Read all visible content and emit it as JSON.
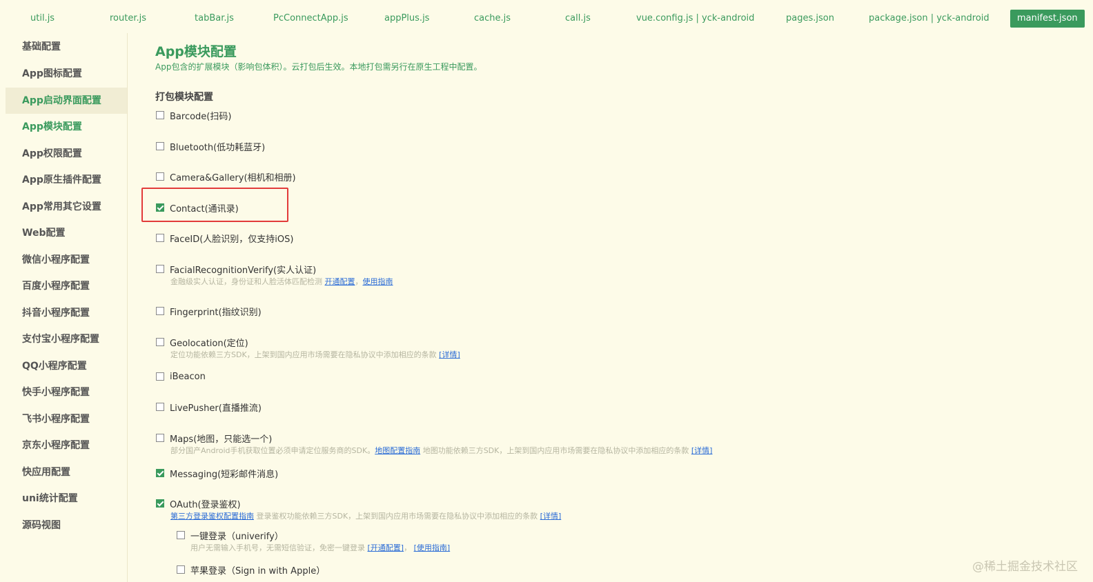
{
  "tabs": [
    {
      "label": "util.js",
      "active": false
    },
    {
      "label": "router.js",
      "active": false
    },
    {
      "label": "tabBar.js",
      "active": false
    },
    {
      "label": "PcConnectApp.js",
      "active": false
    },
    {
      "label": "appPlus.js",
      "active": false
    },
    {
      "label": "cache.js",
      "active": false
    },
    {
      "label": "call.js",
      "active": false
    },
    {
      "label": "vue.config.js | yck-android",
      "active": false
    },
    {
      "label": "pages.json",
      "active": false
    },
    {
      "label": "package.json | yck-android",
      "active": false
    },
    {
      "label": "manifest.json",
      "active": true
    }
  ],
  "sidebar": {
    "items": [
      {
        "label": "基础配置"
      },
      {
        "label": "App图标配置"
      },
      {
        "label": "App启动界面配置"
      },
      {
        "label": "App模块配置"
      },
      {
        "label": "App权限配置"
      },
      {
        "label": "App原生插件配置"
      },
      {
        "label": "App常用其它设置"
      },
      {
        "label": "Web配置"
      },
      {
        "label": "微信小程序配置"
      },
      {
        "label": "百度小程序配置"
      },
      {
        "label": "抖音小程序配置"
      },
      {
        "label": "支付宝小程序配置"
      },
      {
        "label": "QQ小程序配置"
      },
      {
        "label": "快手小程序配置"
      },
      {
        "label": "飞书小程序配置"
      },
      {
        "label": "京东小程序配置"
      },
      {
        "label": "快应用配置"
      },
      {
        "label": "uni统计配置"
      },
      {
        "label": "源码视图"
      }
    ]
  },
  "main": {
    "title": "App模块配置",
    "subtitle": "App包含的扩展模块（影响包体积）。云打包后生效。本地打包需另行在原生工程中配置。",
    "section_title": "打包模块配置",
    "modules": [
      {
        "label": "Barcode(扫码)",
        "checked": false
      },
      {
        "label": "Bluetooth(低功耗蓝牙)",
        "checked": false
      },
      {
        "label": "Camera&Gallery(相机和相册)",
        "checked": false
      },
      {
        "label": "Contact(通讯录)",
        "checked": true
      },
      {
        "label": "FaceID(人脸识别，仅支持iOS)",
        "checked": false
      },
      {
        "label": "FacialRecognitionVerify(实人认证)",
        "checked": false
      },
      {
        "label": "Fingerprint(指纹识别)",
        "checked": false
      },
      {
        "label": "Geolocation(定位)",
        "checked": false
      },
      {
        "label": "iBeacon",
        "checked": false
      },
      {
        "label": "LivePusher(直播推流)",
        "checked": false
      },
      {
        "label": "Maps(地图，只能选一个)",
        "checked": false
      },
      {
        "label": "Messaging(短彩邮件消息)",
        "checked": true
      },
      {
        "label": "OAuth(登录鉴权)",
        "checked": true
      },
      {
        "label": "一键登录（univerify）",
        "checked": false
      },
      {
        "label": "苹果登录（Sign in with Apple）",
        "checked": false
      }
    ],
    "desc_facial": {
      "text": "金融级实人认证，身份证和人脸活体匹配检测 ",
      "link1": "开通配置",
      "sep": "，",
      "link2": "使用指南"
    },
    "desc_geo": {
      "text": "定位功能依赖三方SDK，上架到国内应用市场需要在隐私协议中添加相应的条款 ",
      "link": "[详情]"
    },
    "desc_maps": {
      "text1": "部分国产Android手机获取位置必须申请定位服务商的SDK。",
      "link1": "地图配置指南",
      "text2": " 地图功能依赖三方SDK，上架到国内应用市场需要在隐私协议中添加相应的条款 ",
      "link2": "[详情]"
    },
    "desc_oauth": {
      "link1": "第三方登录鉴权配置指南",
      "text": " 登录鉴权功能依赖三方SDK，上架到国内应用市场需要在隐私协议中添加相应的条款 ",
      "link2": "[详情]"
    },
    "desc_univerify": {
      "text": "用户无需输入手机号，无需短信验证，免密一键登录 ",
      "link1": "[开通配置]",
      "sep": "，  ",
      "link2": "[使用指南]"
    }
  },
  "watermark": "@稀土掘金技术社区",
  "colors": {
    "accent": "#3a9a5d",
    "background": "#fdfbe8",
    "link": "#2a6bd6",
    "highlight": "#e23a3a"
  }
}
